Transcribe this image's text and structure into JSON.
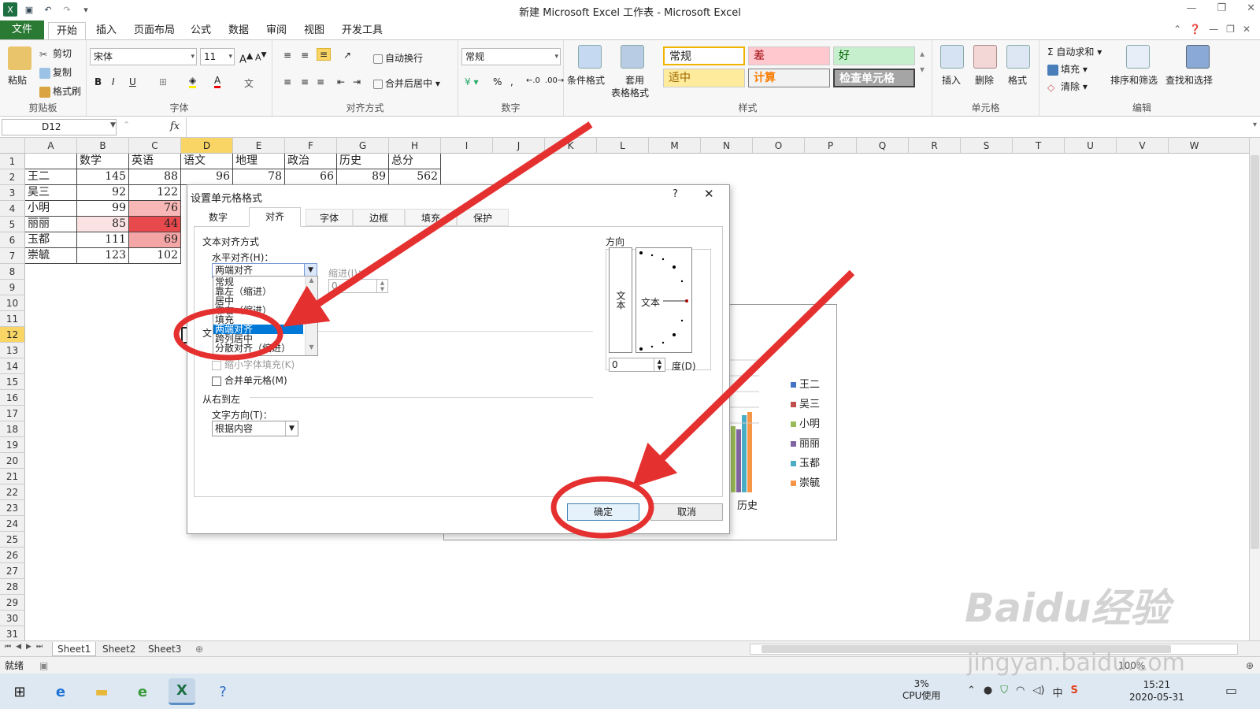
{
  "titlebar": {
    "title": "新建 Microsoft Excel 工作表 - Microsoft Excel"
  },
  "ribbon_tabs": [
    "文件",
    "开始",
    "插入",
    "页面布局",
    "公式",
    "数据",
    "审阅",
    "视图",
    "开发工具"
  ],
  "ribbon": {
    "clipboard": {
      "paste": "粘贴",
      "cut": "剪切",
      "copy": "复制",
      "format_painter": "格式刷",
      "label": "剪贴板"
    },
    "font": {
      "name": "宋体",
      "size": "11",
      "label": "字体"
    },
    "alignment": {
      "wrap": "自动换行",
      "merge": "合并后居中",
      "label": "对齐方式"
    },
    "number": {
      "format": "常规",
      "percent": "%",
      "comma": ",",
      "label": "数字"
    },
    "styles": {
      "conditional": "条件格式",
      "table": "套用",
      "table2": "表格格式",
      "normal": "常规",
      "bad": "差",
      "good": "好",
      "neutral": "适中",
      "calc": "计算",
      "check": "检查单元格",
      "label": "样式"
    },
    "cells": {
      "insert": "插入",
      "delete": "删除",
      "format": "格式",
      "label": "单元格"
    },
    "editing": {
      "autosum": "自动求和",
      "fill": "填充",
      "clear": "清除",
      "sort": "排序和筛选",
      "find": "查找和选择",
      "label": "编辑"
    }
  },
  "formula_bar": {
    "cell_ref": "D12",
    "fx": "fx",
    "value": ""
  },
  "columns": [
    "A",
    "B",
    "C",
    "D",
    "E",
    "F",
    "G",
    "H",
    "I",
    "J",
    "K",
    "L",
    "M",
    "N",
    "O",
    "P",
    "Q",
    "R",
    "S",
    "T",
    "U",
    "V",
    "W"
  ],
  "rows": [
    "1",
    "2",
    "3",
    "4",
    "5",
    "6",
    "7",
    "8",
    "9",
    "10",
    "11",
    "12",
    "13",
    "14",
    "15",
    "16",
    "17",
    "18",
    "19",
    "20",
    "21",
    "22",
    "23",
    "24",
    "25",
    "26",
    "27",
    "28",
    "29",
    "30",
    "31"
  ],
  "table": {
    "header": [
      "",
      "数学",
      "英语",
      "语文",
      "地理",
      "政治",
      "历史",
      "总分"
    ],
    "row2": [
      "王二",
      "145",
      "88",
      "96",
      "78",
      "66",
      "89",
      "562"
    ],
    "names": [
      "吴三",
      "小明",
      "丽丽",
      "玉都",
      "崇毓"
    ],
    "math": [
      "92",
      "99",
      "85",
      "111",
      "123"
    ],
    "english": [
      "122",
      "76",
      "44",
      "69",
      "102"
    ]
  },
  "sheets": [
    "Sheet1",
    "Sheet2",
    "Sheet3"
  ],
  "status": {
    "ready": "就绪",
    "zoom": "100%"
  },
  "taskbar": {
    "cpu_pct": "3%",
    "cpu_label": "CPU使用",
    "time": "15:21",
    "date": "2020-05-31",
    "ime": "中"
  },
  "dialog": {
    "title": "设置单元格格式",
    "help": "?",
    "tabs": [
      "数字",
      "对齐",
      "字体",
      "边框",
      "填充",
      "保护"
    ],
    "text_alignment": "文本对齐方式",
    "horizontal_label": "水平对齐(H)：",
    "horizontal_value": "两端对齐",
    "indent_label": "缩进(I)：",
    "indent_value": "0",
    "options": [
      "常规",
      "靠左（缩进）",
      "居中",
      "靠右（缩进）",
      "填充",
      "两端对齐",
      "跨列居中",
      "分散对齐（缩进）"
    ],
    "text_control_partial": "文",
    "shrink": "缩小字体填充(K)",
    "merge": "合并单元格(M)",
    "rtl": "从右到左",
    "text_direction_label": "文字方向(T)：",
    "text_direction_value": "根据内容",
    "orientation": "方向",
    "vertical_text": "文本",
    "rotated_text": "文本",
    "degree_value": "0",
    "degree_label": "度(D)",
    "ok": "确定",
    "cancel": "取消"
  },
  "chart": {
    "x_label": "历史",
    "legend": [
      "王二",
      "吴三",
      "小明",
      "丽丽",
      "玉都",
      "崇毓"
    ],
    "colors": [
      "#4472c4",
      "#c0504d",
      "#9bbb59",
      "#8064a2",
      "#4bacc6",
      "#f79646"
    ]
  },
  "watermark": {
    "logo": "Baidu经验",
    "url": "jingyan.baidu.com"
  }
}
